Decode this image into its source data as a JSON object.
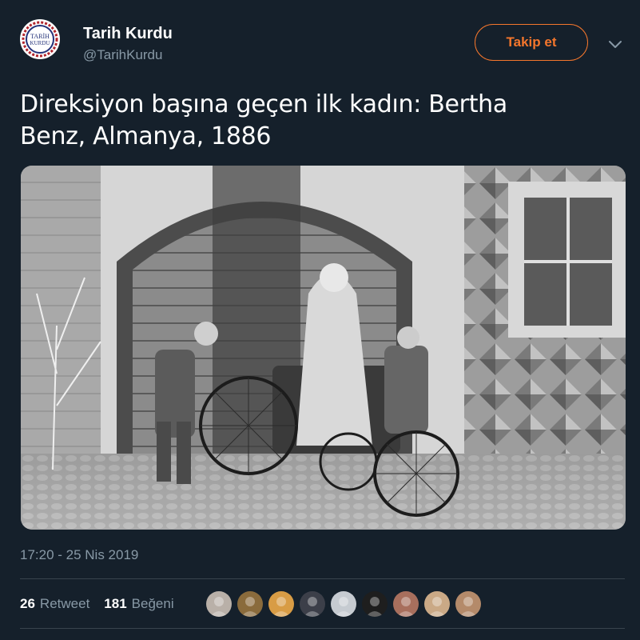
{
  "account": {
    "display_name": "Tarih Kurdu",
    "handle": "@TarihKurdu",
    "avatar_text_line1": "TARİH",
    "avatar_text_line2": "KURDU"
  },
  "follow_button": {
    "label": "Takip et"
  },
  "tweet": {
    "text_line1": "Direksiyon başına geçen ilk kadın: Bertha",
    "text_line2": "Benz, Almanya, 1886",
    "timestamp": "17:20 - 25 Nis 2019"
  },
  "stats": {
    "retweets": {
      "count": "26",
      "label": "Retweet"
    },
    "likes": {
      "count": "181",
      "label": "Beğeni"
    }
  },
  "likers": [
    {
      "name": "liker-avatar-1",
      "color": "#b9b0a8"
    },
    {
      "name": "liker-avatar-2",
      "color": "#8a6b3c"
    },
    {
      "name": "liker-avatar-3",
      "color": "#d89c45"
    },
    {
      "name": "liker-avatar-4",
      "color": "#3c3f49"
    },
    {
      "name": "liker-avatar-5",
      "color": "#c6cbd1"
    },
    {
      "name": "liker-avatar-6",
      "color": "#1e1e1e"
    },
    {
      "name": "liker-avatar-7",
      "color": "#a86f5d"
    },
    {
      "name": "liker-avatar-8",
      "color": "#caa986"
    },
    {
      "name": "liker-avatar-9",
      "color": "#b48a6a"
    }
  ],
  "colors": {
    "background": "#15202b",
    "accent": "#f4762c",
    "secondary_text": "#8899a6",
    "divider": "#38444d"
  }
}
